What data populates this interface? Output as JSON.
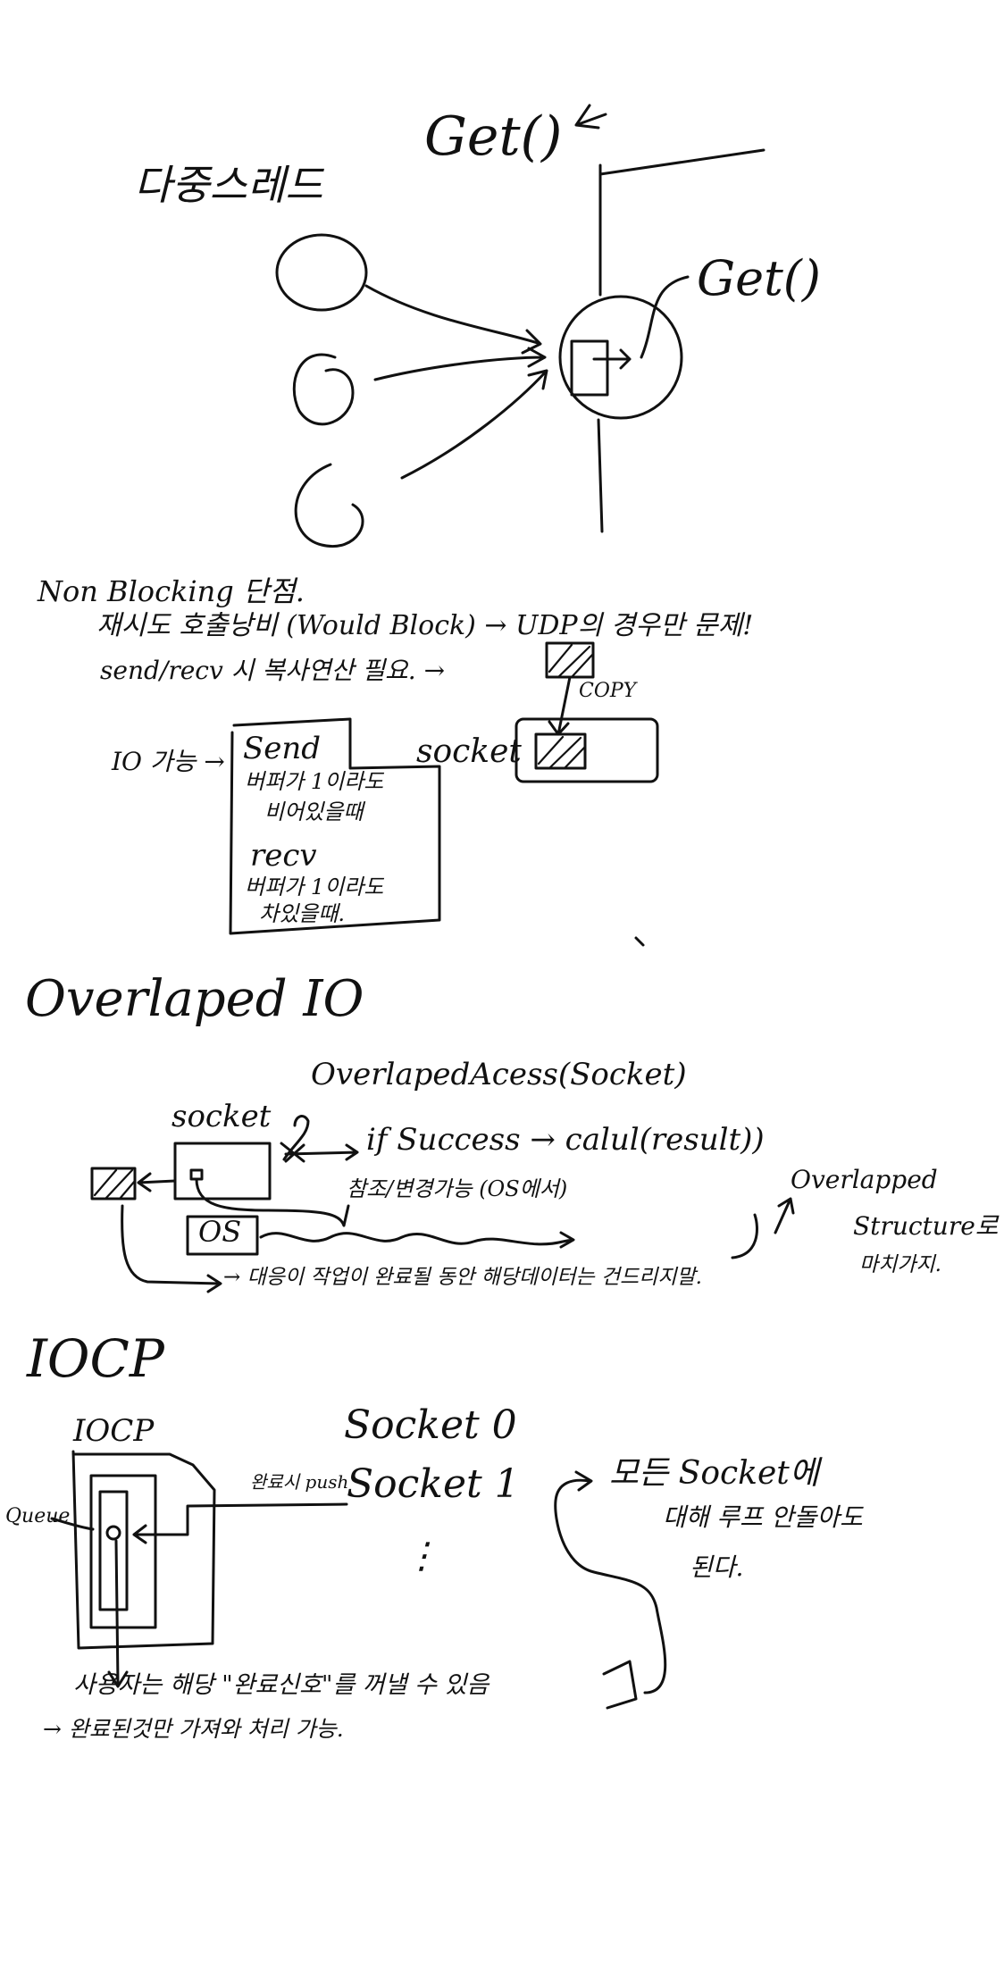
{
  "section1": {
    "title": "다중스레드",
    "get_top": "Get()",
    "get_right": "Get()"
  },
  "section2": {
    "heading": "Non Blocking 단점.",
    "line1": "재시도 호출낭비 (Would Block) → UDP의 경우만 문제!",
    "line2": "send/recv 시 복사연산 필요. →",
    "copy_label": "COPY",
    "io_label": "IO 가능 →",
    "socket_label": "socket",
    "box_send": "Send",
    "box_send_desc1": "버퍼가 1이라도",
    "box_send_desc2": "비어있을때",
    "box_recv": "recv",
    "box_recv_desc1": "버퍼가 1이라도",
    "box_recv_desc2": "차있을때."
  },
  "section3": {
    "title": "Overlaped IO",
    "socket_label": "socket",
    "call": "OverlapedAcess(Socket)",
    "success": "if Success → calul(result))",
    "ref_note": "참조/변경가능 (OS에서)",
    "os_label": "OS",
    "overlapped_label1": "Overlapped",
    "overlapped_label2": "Structure로",
    "bottom_note": "→ 대응이 작업이 완료될 동안 해당데이터는 건드리지말.",
    "bottom_note2": "마치가지."
  },
  "section4": {
    "title": "IOCP",
    "box_label": "IOCP",
    "queue_label": "Queue",
    "push_label": "완료시 push",
    "socket0": "Socket 0",
    "socket1": "Socket 1",
    "dots": "⋮",
    "note1": "모든 Socket에",
    "note2": "대해 루프 안돌아도",
    "note3": "된다.",
    "bottom1": "사용자는 해당 \"완료신호\"를 꺼낼 수 있음",
    "bottom2": "→ 완료된것만 가져와 처리 가능."
  }
}
